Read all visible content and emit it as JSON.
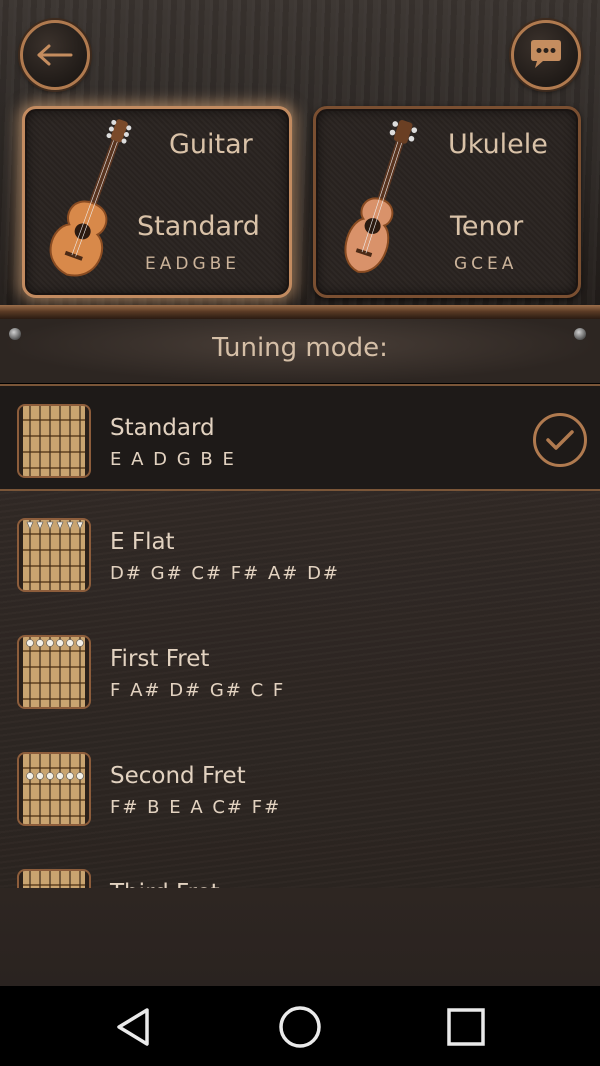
{
  "header": {
    "back_icon": "arrow-left-icon",
    "chat_icon": "chat-bubble-icon"
  },
  "instruments": [
    {
      "name": "Guitar",
      "tuning": "Standard",
      "notes": "EADGBE",
      "selected": true
    },
    {
      "name": "Ukulele",
      "tuning": "Tenor",
      "notes": "GCEA",
      "selected": false
    }
  ],
  "tuning_mode": {
    "title": "Tuning mode:"
  },
  "tunings": [
    {
      "name": "Standard",
      "notes": "E A D G B E",
      "selected": true
    },
    {
      "name": "E Flat",
      "notes": "D# G# C# F# A# D#",
      "selected": false
    },
    {
      "name": "First Fret",
      "notes": "F A# D# G# C F",
      "selected": false
    },
    {
      "name": "Second Fret",
      "notes": "F# B E A C# F#",
      "selected": false
    },
    {
      "name": "Third Fret",
      "notes": "",
      "selected": false
    }
  ],
  "colors": {
    "accent": "#b07a4f",
    "text": "#e2d2c0",
    "background": "#2c2521"
  },
  "navbar": {
    "back_icon": "nav-back-icon",
    "home_icon": "nav-home-icon",
    "recents_icon": "nav-recents-icon"
  }
}
